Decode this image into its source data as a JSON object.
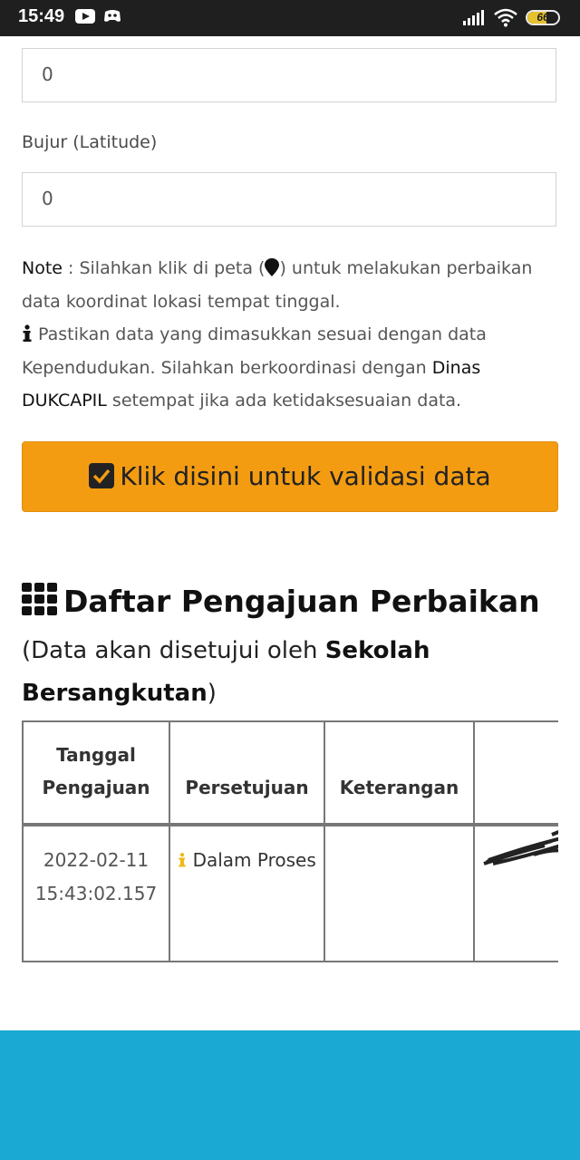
{
  "status_bar": {
    "time": "15:49",
    "battery": "66"
  },
  "form": {
    "latitude_value": "0",
    "longitude_label": "Bujur (Latitude)",
    "longitude_value": "0"
  },
  "note": {
    "prefix": "Note",
    "part1": " : Silahkan klik di peta (",
    "part2": ") untuk melakukan perbaikan data koordinat lokasi tempat tinggal.",
    "info_text": " Pastikan data yang dimasukkan sesuai dengan data Kependudukan. Silahkan berkoordinasi dengan ",
    "dinas": "Dinas DUKCAPIL",
    "info_tail": " setempat jika ada ketidaksesuaian data."
  },
  "validate_button": {
    "label": "Klik disini untuk validasi data"
  },
  "section": {
    "title": "Daftar Pengajuan Perbaikan",
    "sub_open": "(Data akan disetujui oleh ",
    "sub_bold": "Sekolah Bersangkutan",
    "sub_close": ")"
  },
  "table": {
    "headers": [
      "Tanggal Pengajuan",
      "Persetujuan",
      "Keterangan",
      ""
    ],
    "rows": [
      {
        "date": "2022-02-11 15:43:02.157",
        "status": "Dalam Proses",
        "keterangan": "",
        "extra": ""
      }
    ]
  },
  "colors": {
    "accent_button": "#f39c12",
    "footer": "#1aa9d2",
    "info_icon": "#f1b81a"
  }
}
